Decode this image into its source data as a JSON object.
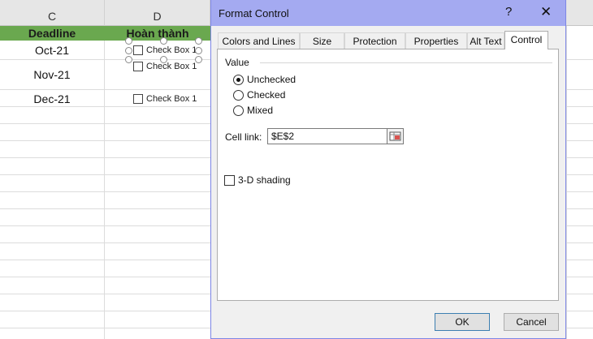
{
  "sheet": {
    "columns": [
      "C",
      "D"
    ],
    "headers": {
      "deadline": "Deadline",
      "done": "Hoàn thành"
    },
    "rows": [
      {
        "date": "Oct-21",
        "checkbox": "Check Box 1"
      },
      {
        "date": "Nov-21",
        "checkbox": "Check Box 1"
      },
      {
        "date": "Dec-21",
        "checkbox": "Check Box 1"
      }
    ],
    "header_color": "#6aa84f"
  },
  "dialog": {
    "title": "Format Control",
    "help": "?",
    "close": "✕",
    "tabs": [
      "Colors and Lines",
      "Size",
      "Protection",
      "Properties",
      "Alt Text",
      "Control"
    ],
    "active_tab": "Control",
    "value_label": "Value",
    "options": [
      {
        "label": "Unchecked",
        "selected": true
      },
      {
        "label": "Checked",
        "selected": false
      },
      {
        "label": "Mixed",
        "selected": false
      }
    ],
    "cell_link_label": "Cell link:",
    "cell_link_value": "$E$2",
    "shading_label": "3-D shading",
    "shading_checked": false,
    "ok": "OK",
    "cancel": "Cancel",
    "titlebar_color": "#a4aaf1"
  }
}
